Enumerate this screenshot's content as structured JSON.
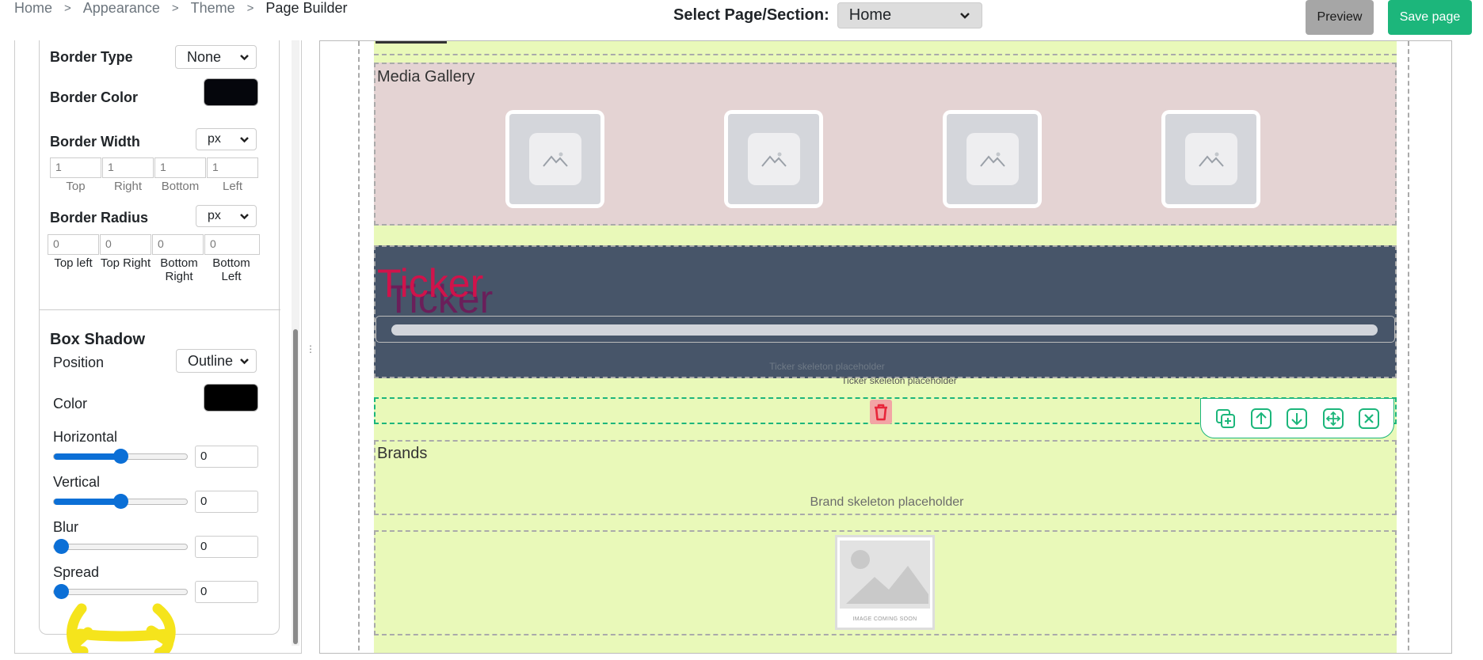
{
  "breadcrumb": {
    "items": [
      "Home",
      "Appearance",
      "Theme",
      "Page Builder"
    ]
  },
  "header": {
    "select_label": "Select Page/Section:",
    "select_value": "Home",
    "preview_label": "Preview",
    "save_label": "Save page"
  },
  "panel": {
    "border_type": {
      "label": "Border Type",
      "value": "None"
    },
    "border_color": {
      "label": "Border Color",
      "color": "#05060c"
    },
    "border_width": {
      "label": "Border Width",
      "unit": "px",
      "values": [
        "1",
        "1",
        "1",
        "1"
      ],
      "sides": [
        "Top",
        "Right",
        "Bottom",
        "Left"
      ]
    },
    "border_radius": {
      "label": "Border Radius",
      "unit": "px",
      "values": [
        "0",
        "0",
        "0",
        "0"
      ],
      "corners": [
        "Top left",
        "Top Right",
        "Bottom Right",
        "Bottom Left"
      ]
    },
    "box_shadow": {
      "title": "Box Shadow",
      "position_label": "Position",
      "position_value": "Outline",
      "color_label": "Color",
      "color": "#000000",
      "horizontal": {
        "label": "Horizontal",
        "value": "0",
        "level": 0.5
      },
      "vertical": {
        "label": "Vertical",
        "value": "0",
        "level": 0.5
      },
      "blur": {
        "label": "Blur",
        "value": "0",
        "level": 0
      },
      "spread": {
        "label": "Spread",
        "value": "0",
        "level": 0
      }
    }
  },
  "canvas": {
    "media_gallery": {
      "title": "Media Gallery",
      "tiles": 4
    },
    "ticker": {
      "title": "Ticker",
      "placeholder": "Ticker skeleton placeholder",
      "placeholder_2": "Ticker skeleton placeholder"
    },
    "brands": {
      "title": "Brands",
      "placeholder": "Brand skeleton placeholder"
    },
    "image_placeholder_caption": "IMAGE COMING SOON"
  },
  "colors": {
    "accent": "#1cb67b",
    "ticker_bg": "#475569",
    "section_bg": "#e9f9b9",
    "gallery_bg": "#e4d3d3"
  }
}
